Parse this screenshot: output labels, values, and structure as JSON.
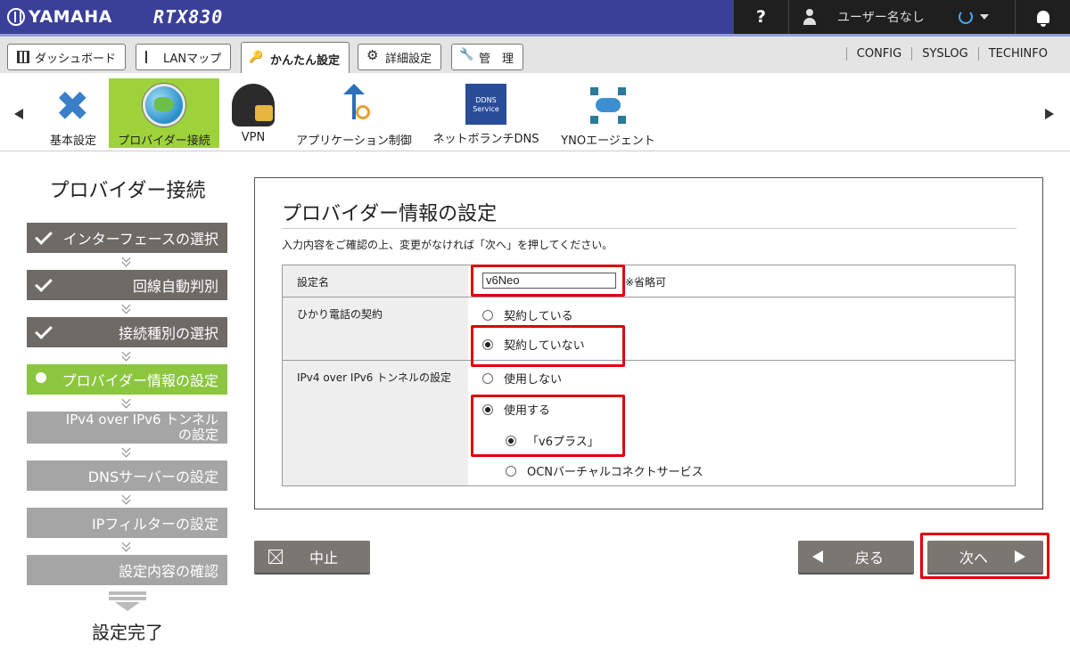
{
  "header": {
    "brand": "YAMAHA",
    "model": "RTX830",
    "help": "?",
    "user": "ユーザー名なし"
  },
  "tabs": [
    {
      "label": "ダッシュボード",
      "icon": "dashboard-icon"
    },
    {
      "label": "LANマップ",
      "icon": "lan-map-icon"
    },
    {
      "label": "かんたん設定",
      "icon": "key-icon",
      "active": true
    },
    {
      "label": "詳細設定",
      "icon": "gear-icon"
    },
    {
      "label": "管　理",
      "icon": "wrench-icon"
    }
  ],
  "toplinks": [
    "CONFIG",
    "SYSLOG",
    "TECHINFO"
  ],
  "iconbar": [
    {
      "label": "基本設定",
      "icon": "tools-icon"
    },
    {
      "label": "プロバイダー接続",
      "icon": "globe-icon",
      "active": true
    },
    {
      "label": "VPN",
      "icon": "vpn-icon"
    },
    {
      "label": "アプリケーション制御",
      "icon": "app-control-icon"
    },
    {
      "label": "ネットボランチDNS",
      "icon": "ddns-icon",
      "badge": "DDNS Service"
    },
    {
      "label": "YNOエージェント",
      "icon": "yno-agent-icon"
    }
  ],
  "sidebar": {
    "title": "プロバイダー接続",
    "steps": [
      {
        "label": "インターフェースの選択",
        "state": "done"
      },
      {
        "label": "回線自動判別",
        "state": "done"
      },
      {
        "label": "接続種別の選択",
        "state": "done"
      },
      {
        "label": "プロバイダー情報の設定",
        "state": "current"
      },
      {
        "label": "IPv4 over IPv6 トンネル",
        "label2": "の設定",
        "state": "pending"
      },
      {
        "label": "DNSサーバーの設定",
        "state": "pending"
      },
      {
        "label": "IPフィルターの設定",
        "state": "pending"
      },
      {
        "label": "設定内容の確認",
        "state": "pending"
      }
    ],
    "finish": "設定完了"
  },
  "panel": {
    "title": "プロバイダー情報の設定",
    "description": "入力内容をご確認の上、変更がなければ「次へ」を押してください。",
    "rows": {
      "name": {
        "label": "設定名",
        "value": "v6Neo",
        "note": "※省略可"
      },
      "phone": {
        "label": "ひかり電話の契約",
        "options": [
          "契約している",
          "契約していない"
        ],
        "selected": 1
      },
      "tunnel": {
        "label": "IPv4 over IPv6 トンネルの設定",
        "options": [
          "使用しない",
          "使用する"
        ],
        "selected": 1,
        "sub_options": [
          "「v6プラス」",
          "OCNバーチャルコネクトサービス"
        ],
        "sub_selected": 0
      }
    }
  },
  "buttons": {
    "cancel": "中止",
    "back": "戻る",
    "next": "次へ"
  },
  "colors": {
    "header_bg": "#3a3f98",
    "accent_green": "#8cc63f",
    "highlight_red": "#e0000b",
    "button_gray": "#7a7672"
  }
}
